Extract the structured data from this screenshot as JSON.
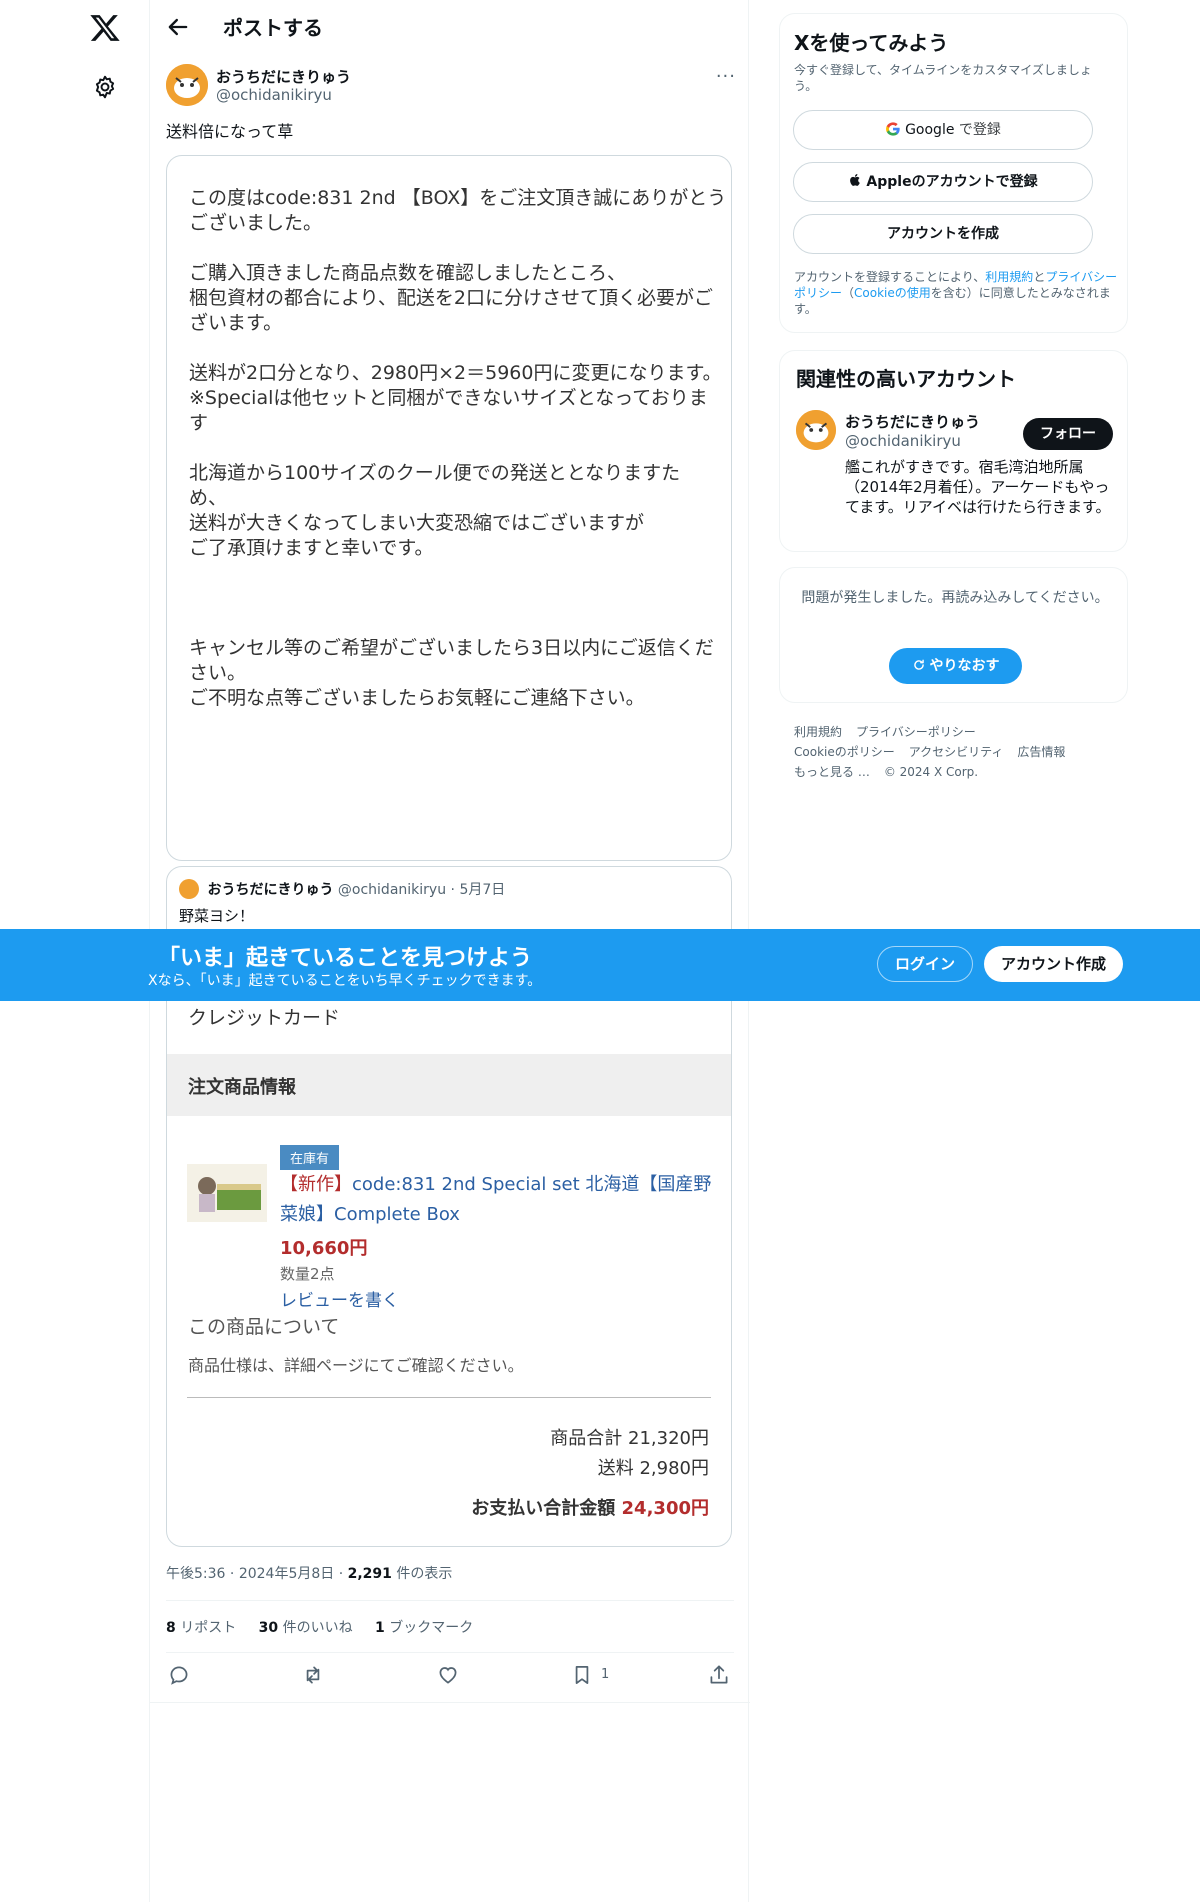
{
  "colors": {
    "accent": "#1d9bf0",
    "text": "#0f1419",
    "muted": "#536471",
    "price_red": "#b32d2d",
    "link_blue": "#2b5fa3"
  },
  "header": {
    "title": "ポストする"
  },
  "post": {
    "author_name": "おうちだにきりゅう",
    "author_handle": "@ochidanikiryu",
    "text": "送料倍になって草",
    "image_lines": [
      "この度はcode:831 2nd 【BOX】をご注文頂き誠にありがとう",
      "ございました。",
      "ご購入頂きました商品点数を確認しましたところ、",
      "梱包資材の都合により、配送を2口に分けさせて頂く必要がご",
      "ざいます。",
      "送料が2口分となり、2980円×2＝5960円に変更になります。",
      "※Specialは他セットと同梱ができないサイズとなっておりま",
      "す",
      "北海道から100サイズのクール便での発送ととなりますた",
      "め、",
      "送料が大きくなってしまい大変恐縮ではございますが",
      "ご了承頂けますと幸いです。",
      "キャンセル等のご希望がございましたら3日以内にご返信くだ",
      "さい。",
      "ご不明な点等ございましたらお気軽にご連絡下さい。"
    ],
    "quote": {
      "author_name": "おうちだにきりゅう",
      "author_handle": "@ochidanikiryu",
      "separator": "·",
      "date": "5月7日",
      "text": "野菜ヨシ！",
      "payment": "クレジットカード",
      "section_title": "注文商品情報",
      "badge": "在庫有",
      "product_new": "【新作】",
      "product_title": "code:831 2nd Special set 北海道【国産野菜娘】Complete Box",
      "price": "10,660円",
      "qty": "数量2点",
      "review_link": "レビューを書く",
      "about_title": "この商品について",
      "about_text": "商品仕様は、詳細ページにてご確認ください。",
      "subtotal": "商品合計 21,320円",
      "shipping": "送料 2,980円",
      "total_label": "お支払い合計金額",
      "total_value": "24,300円"
    },
    "time": "午後5:36",
    "date": "2024年5月8日",
    "dot": "·",
    "views_count": "2,291",
    "views_label": "件の表示",
    "reposts_count": "8",
    "reposts_label": "リポスト",
    "likes_count": "30",
    "likes_label": "件のいいね",
    "bookmarks_count": "1",
    "bookmarks_label": "ブックマーク",
    "bookmark_action_count": "1"
  },
  "sidebar": {
    "signup": {
      "title": "Xを使ってみよう",
      "subtitle": "今すぐ登録して、タイムラインをカスタマイズしましょう。",
      "google_label": "Google",
      "google_suffix": "で登録",
      "apple_label": "Appleのアカウントで登録",
      "create_label": "アカウントを作成",
      "legal_prefix": "アカウントを登録することにより、",
      "legal_terms": "利用規約",
      "legal_and": "と",
      "legal_privacy": "プライバシーポリシー",
      "legal_paren_open": "（",
      "legal_cookie": "Cookieの使用",
      "legal_suffix": "を含む）に同意したとみなされます。"
    },
    "related": {
      "title": "関連性の高いアカウント",
      "name": "おうちだにきりゅう",
      "handle": "@ochidanikiryu",
      "follow_label": "フォロー",
      "bio": "艦これがすきです。宿毛湾泊地所属（2014年2月着任）。アーケードもやってます。リアイベは行けたら行きます。"
    },
    "error": {
      "text": "問題が発生しました。再読み込みしてください。",
      "retry_label": "やりなおす"
    },
    "footer": [
      "利用規約",
      "プライバシーポリシー",
      "Cookieのポリシー",
      "アクセシビリティ",
      "広告情報",
      "もっと見る …",
      "© 2024 X Corp."
    ]
  },
  "banner": {
    "title": "「いま」起きていることを見つけよう",
    "subtitle": "Xなら、「いま」起きていることをいち早くチェックできます。",
    "login_label": "ログイン",
    "signup_label": "アカウント作成"
  }
}
